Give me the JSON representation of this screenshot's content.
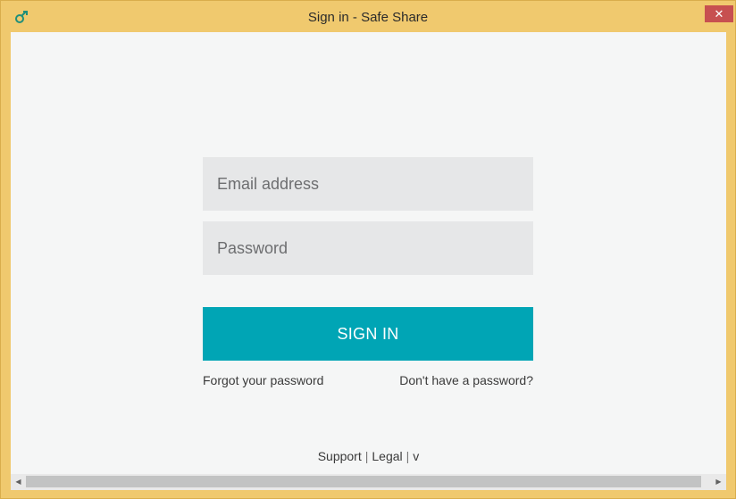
{
  "window": {
    "title": "Sign in - Safe Share",
    "close_glyph": "✕",
    "app_icon": "safe-share-logo-icon"
  },
  "form": {
    "email_placeholder": "Email address",
    "password_placeholder": "Password",
    "signin_label": "SIGN IN",
    "forgot_label": "Forgot your password",
    "no_password_label": "Don't have a password?"
  },
  "footer": {
    "support_label": "Support",
    "separator": "|",
    "legal_label": "Legal",
    "version_label": "v"
  },
  "scrollbar": {
    "left_arrow": "◀",
    "right_arrow": "▶"
  },
  "colors": {
    "frame": "#f0c96e",
    "primary_button": "#00a5b5",
    "field_bg": "#e6e7e8",
    "close_button": "#c75050",
    "content_bg": "#f5f6f6"
  }
}
